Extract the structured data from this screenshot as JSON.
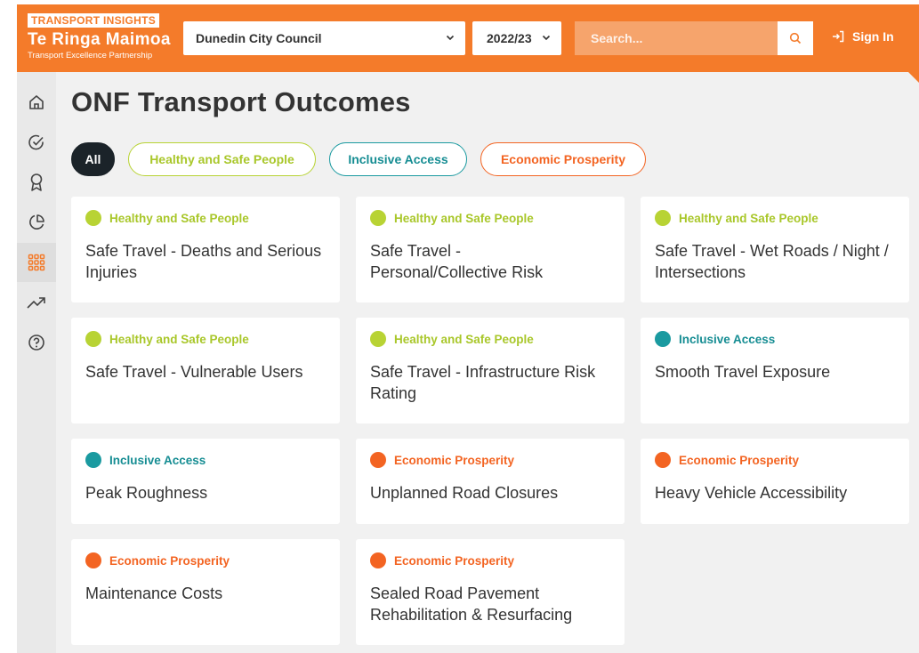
{
  "header": {
    "logo": {
      "top": "TRANSPORT INSIGHTS",
      "main": "Te Ringa Maimoa",
      "sub": "Transport Excellence Partnership"
    },
    "council_select": "Dunedin City Council",
    "year_select": "2022/23",
    "search_placeholder": "Search...",
    "sign_in": "Sign In"
  },
  "sidebar": {
    "items": [
      {
        "icon": "home-icon",
        "active": false
      },
      {
        "icon": "check-circle-icon",
        "active": false
      },
      {
        "icon": "award-icon",
        "active": false
      },
      {
        "icon": "pie-chart-icon",
        "active": false
      },
      {
        "icon": "grid-icon",
        "active": true
      },
      {
        "icon": "trending-up-icon",
        "active": false
      },
      {
        "icon": "help-circle-icon",
        "active": false
      }
    ]
  },
  "page_title": "ONF Transport Outcomes",
  "filters": {
    "all": "All",
    "healthy_safe": "Healthy and Safe People",
    "inclusive": "Inclusive Access",
    "economic": "Economic Prosperity"
  },
  "colors": {
    "brand": "#f47b2a",
    "healthy_safe": "#b8d334",
    "inclusive": "#1a9aa0",
    "economic": "#f36422",
    "dark": "#1b2329"
  },
  "cards": [
    {
      "category": "Healthy and Safe People",
      "title": "Safe Travel - Deaths and Serious Injuries"
    },
    {
      "category": "Healthy and Safe People",
      "title": "Safe Travel - Personal/Collective Risk"
    },
    {
      "category": "Healthy and Safe People",
      "title": "Safe Travel - Wet Roads / Night / Intersections"
    },
    {
      "category": "Healthy and Safe People",
      "title": "Safe Travel - Vulnerable Users"
    },
    {
      "category": "Healthy and Safe People",
      "title": "Safe Travel - Infrastructure Risk Rating"
    },
    {
      "category": "Inclusive Access",
      "title": "Smooth Travel Exposure"
    },
    {
      "category": "Inclusive Access",
      "title": "Peak Roughness"
    },
    {
      "category": "Economic Prosperity",
      "title": "Unplanned Road Closures"
    },
    {
      "category": "Economic Prosperity",
      "title": "Heavy Vehicle Accessibility"
    },
    {
      "category": "Economic Prosperity",
      "title": "Maintenance Costs"
    },
    {
      "category": "Economic Prosperity",
      "title": "Sealed Road Pavement Rehabilitation & Resurfacing"
    }
  ]
}
